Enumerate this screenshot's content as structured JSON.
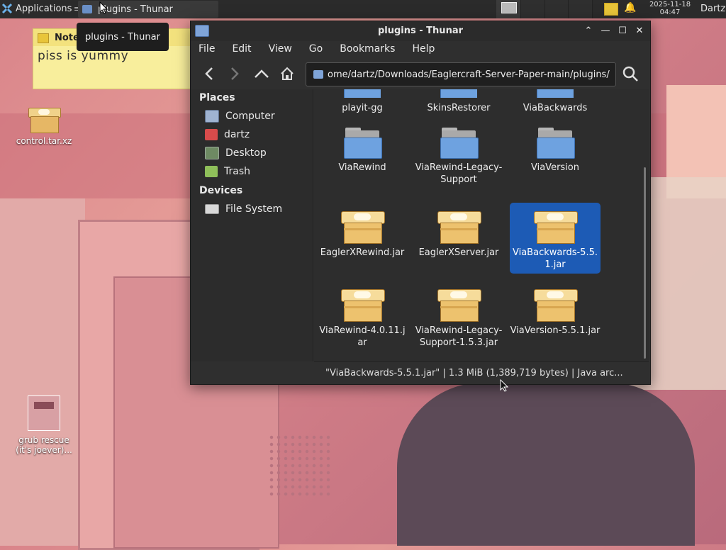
{
  "panel": {
    "applications_label": "Applications",
    "separator": "≡",
    "task_label": "plugins - Thunar",
    "clock_date": "2025-11-18",
    "clock_time": "04:47",
    "user": "Dartz"
  },
  "tooltip": "plugins - Thunar",
  "note": {
    "title": "Notes",
    "text": "piss  is yummy"
  },
  "desktop": [
    {
      "label": "control.tar.xz",
      "kind": "archive"
    },
    {
      "label_line1": "grub rescue",
      "label_line2": "(it's joever)...",
      "kind": "image"
    }
  ],
  "window": {
    "title": "plugins - Thunar",
    "menu": [
      "File",
      "Edit",
      "View",
      "Go",
      "Bookmarks",
      "Help"
    ],
    "address": "ome/dartz/Downloads/Eaglercraft-Server-Paper-main/plugins/",
    "sidebar": {
      "places_label": "Places",
      "places": [
        "Computer",
        "dartz",
        "Desktop",
        "Trash"
      ],
      "devices_label": "Devices",
      "devices": [
        "File System"
      ]
    },
    "items": [
      {
        "name": "playit-gg",
        "kind": "folder"
      },
      {
        "name": "SkinsRestorer",
        "kind": "folder"
      },
      {
        "name": "ViaBackwards",
        "kind": "folder"
      },
      {
        "name": "ViaRewind",
        "kind": "folder"
      },
      {
        "name1": "ViaRewind-Legacy-",
        "name2": "Support",
        "kind": "folder"
      },
      {
        "name": "ViaVersion",
        "kind": "folder"
      },
      {
        "name": "EaglerXRewind.jar",
        "kind": "jar"
      },
      {
        "name": "EaglerXServer.jar",
        "kind": "jar"
      },
      {
        "name1": "ViaBackwards-5.5.",
        "name2": "1.jar",
        "kind": "jar",
        "selected": true
      },
      {
        "name1": "ViaRewind-4.0.11.j",
        "name2": "ar",
        "kind": "jar"
      },
      {
        "name1": "ViaRewind-Legacy-",
        "name2": "Support-1.5.3.jar",
        "kind": "jar"
      },
      {
        "name": "ViaVersion-5.5.1.jar",
        "kind": "jar"
      }
    ],
    "status": "\"ViaBackwards-5.5.1.jar\"  |  1.3 MiB (1,389,719 bytes)  |  Java arc..."
  },
  "colors": {
    "selection": "#1d5bb5",
    "panel": "#2b2b2b",
    "window_bg": "#2d2d2d"
  }
}
